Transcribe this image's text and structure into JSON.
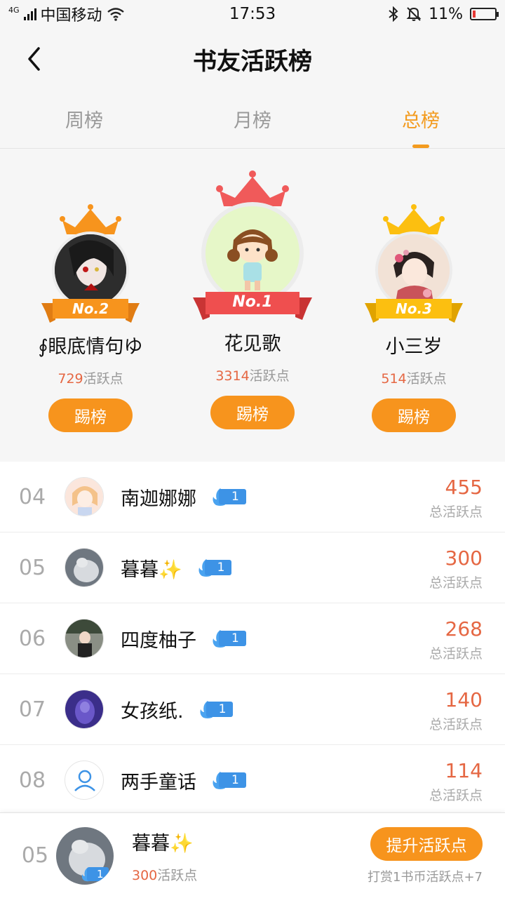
{
  "status": {
    "network": "4G",
    "carrier": "中国移动",
    "time": "17:53",
    "battery": "11%"
  },
  "header": {
    "title": "书友活跃榜"
  },
  "tabs": [
    {
      "label": "周榜",
      "active": false
    },
    {
      "label": "月榜",
      "active": false
    },
    {
      "label": "总榜",
      "active": true
    }
  ],
  "podium": {
    "first": {
      "rank": "No.1",
      "name": "花见歌",
      "points": "3314",
      "suffix": "活跃点",
      "button": "踢榜",
      "crown_color": "#f05a5a",
      "ribbon_color": "#ef4f4f"
    },
    "second": {
      "rank": "No.2",
      "name": "∮眼底情句ゆ",
      "points": "729",
      "suffix": "活跃点",
      "button": "踢榜",
      "crown_color": "#f7941d",
      "ribbon_color": "#f7941d"
    },
    "third": {
      "rank": "No.3",
      "name": "小三岁",
      "points": "514",
      "suffix": "活跃点",
      "button": "踢榜",
      "crown_color": "#fcbf10",
      "ribbon_color": "#fcbf10"
    }
  },
  "list": [
    {
      "rank": "04",
      "name": "南迦娜娜",
      "level": "1",
      "score": "455",
      "label": "总活跃点"
    },
    {
      "rank": "05",
      "name": "暮暮✨",
      "level": "1",
      "score": "300",
      "label": "总活跃点"
    },
    {
      "rank": "06",
      "name": "四度柚子",
      "level": "1",
      "score": "268",
      "label": "总活跃点"
    },
    {
      "rank": "07",
      "name": "女孩纸.",
      "level": "1",
      "score": "140",
      "label": "总活跃点"
    },
    {
      "rank": "08",
      "name": "两手童话",
      "level": "1",
      "score": "114",
      "label": "总活跃点"
    }
  ],
  "me": {
    "rank": "05",
    "name": "暮暮✨",
    "level": "1",
    "points": "300",
    "suffix": "活跃点",
    "button": "提升活跃点",
    "tip": "打赏1书币活跃点+7"
  },
  "colors": {
    "accent": "#f7941d",
    "score": "#e56743",
    "badge": "#3d93e6"
  }
}
